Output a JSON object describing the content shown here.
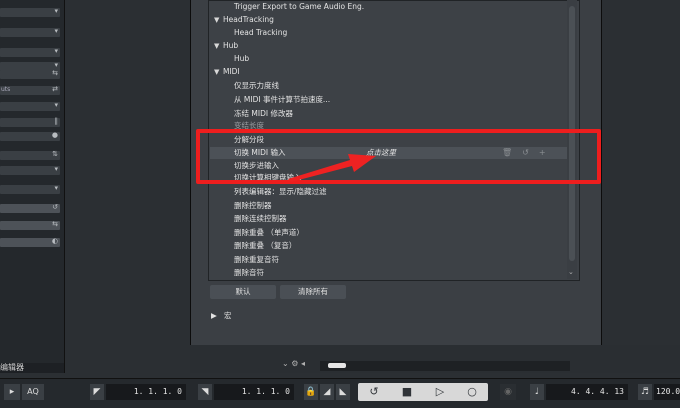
{
  "dialog": {
    "categories": [
      {
        "name": "HeadTracking",
        "commands": [
          "Head Tracking"
        ]
      },
      {
        "name": "Hub",
        "commands": [
          "Hub"
        ]
      },
      {
        "name": "MIDI",
        "commands": [
          "仅显示力度线",
          "从 MIDI 事件计算节拍速度...",
          "冻结 MIDI 修改器",
          "变结长度",
          "分解分段",
          "切换 MIDI 输入",
          "切换步进输入",
          "切换计算相键盘输入",
          "列表编辑器：显示/隐藏过滤",
          "删除控制器",
          "删除连续控制器",
          "删除重叠 （单声道）",
          "删除重叠 （复音）",
          "删除重复音符",
          "删除音符"
        ]
      }
    ],
    "top_item": "Trigger Export to Game Audio Eng.",
    "edit_hint": "点击这里",
    "default_button": "默认",
    "clear_all_button": "清除所有",
    "macro_label": "宏"
  },
  "left_panel": {
    "rows": [
      {
        "label": "",
        "symbol": "▾"
      },
      {
        "label": "",
        "symbol": "▾"
      },
      {
        "label": "",
        "symbol": "▾"
      },
      {
        "label": "",
        "symbol": "▾"
      },
      {
        "label": "",
        "symbol": "⇆"
      },
      {
        "label": "uts",
        "symbol": "⇄"
      },
      {
        "label": "",
        "symbol": "▾"
      },
      {
        "label": "",
        "symbol": "‖"
      },
      {
        "label": "",
        "symbol": "●"
      },
      {
        "label": "",
        "symbol": "⇅"
      },
      {
        "label": "",
        "symbol": "▾"
      },
      {
        "label": "",
        "symbol": "▾"
      },
      {
        "label": "",
        "symbol": "↺"
      },
      {
        "label": "",
        "symbol": "⇆"
      },
      {
        "label": "",
        "symbol": "◐"
      }
    ],
    "bottom_label": "编辑器"
  },
  "transport": {
    "aq_label": "AQ",
    "left_locator": "1. 1. 1. 0",
    "right_locator": "1. 1. 1. 0",
    "position": "4. 4. 4. 13",
    "tempo": "120.0"
  }
}
